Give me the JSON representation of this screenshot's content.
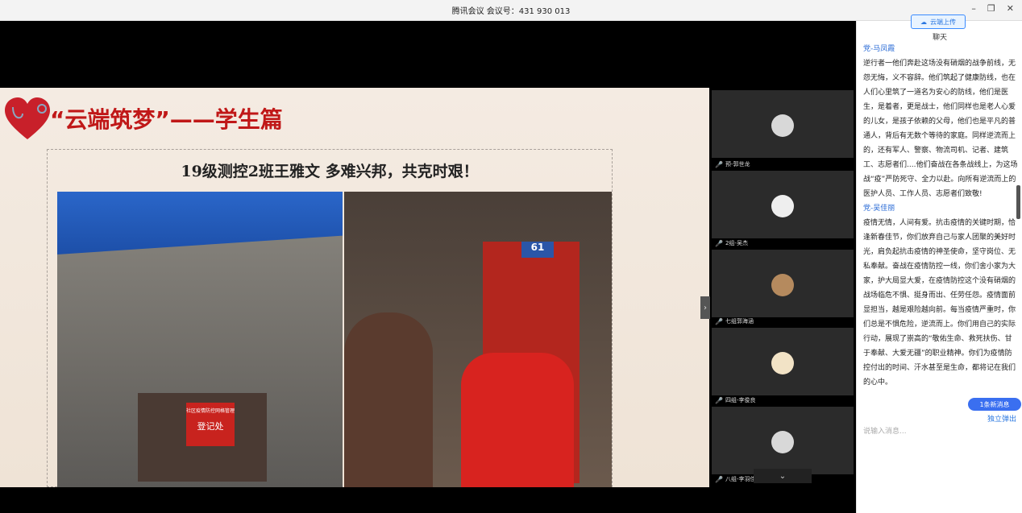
{
  "titlebar": {
    "title": "腾讯会议 会议号：431 930 013"
  },
  "slide": {
    "title": "“云端筑梦”——学生篇",
    "subtitle": "19级测控2班王雅文  多难兴邦，共克时艰！",
    "signboard_label": "登记处",
    "signboard_sub": "社区疫情防控网格管理",
    "door_number": "61"
  },
  "tiles": [
    {
      "name": "预-郭世龙"
    },
    {
      "name": "2组-吴杰"
    },
    {
      "name": "七组郭海涵"
    },
    {
      "name": "四组-李俊良"
    },
    {
      "name": "八组-李羽佳"
    }
  ],
  "chat": {
    "header": "聊天",
    "upload_label": "云端上传",
    "messages": [
      {
        "sender": "党-马凤霞",
        "text": "逆行者一他们奔赴这场没有硝烟的战争前线，无怨无悔，义不容辞。他们筑起了健康防线，也在人们心里筑了一道名为安心的防线，他们是医生，是着者，更是战士，他们同样也是老人心爱的儿女，是孩子依赖的父母，他们也是平凡的普通人，背后有无数个等待的家庭。同样逆流而上的，还有军人、警察、物流司机、记者、建筑工、志愿者们....他们奋战在各条战线上，为这场战“疫”严防死守、全力以赴。向所有逆流而上的医护人员、工作人员、志愿者们致敬!"
      },
      {
        "sender": "党-吴佳丽",
        "text": "疫情无情，人间有爱。抗击疫情的关键时期，恰逢新春佳节，你们放弃自己与家人团聚的美好时光，肩负起抗击疫情的神圣使命，坚守岗位、无私奉献。奋战在疫情防控一线，你们舍小家为大家，护大局显大爱，在疫情防控这个没有硝烟的战场临危不惧、挺身而出、任劳任怨。疫情面前显担当，越是艰险越向前。每当疫情严重时，你们总是不惧危险，逆流而上。你们用自己的实际行动，展现了崇高的“敬佑生命、救死扶伤、甘于奉献、大爱无疆”的职业精神。你们为疫情防控付出的时间、汗水甚至是生命，都将记在我们的心中。"
      }
    ],
    "new_messages_label": "1条新消息",
    "popout_label": "独立弹出",
    "input_placeholder": "说输入消息..."
  },
  "colors": {
    "accent": "#1ed083",
    "title_red": "#c01818",
    "link_blue": "#2a6bd6"
  }
}
